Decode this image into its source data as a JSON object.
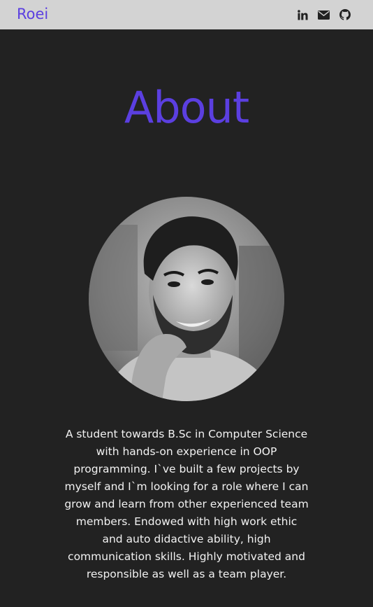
{
  "navbar": {
    "brand": "Roei",
    "icons": [
      "linkedin-icon",
      "mail-icon",
      "github-icon"
    ],
    "background": "#d3d3d3",
    "brand_color": "#5b3fe0"
  },
  "about": {
    "title": "About",
    "title_color": "#5b3fe0",
    "bio": "A student towards B.Sc in Computer Science with hands-on experience in OOP programming. I`ve built a few projects by myself and I`m looking for a role where I can grow and learn from other experienced team members. Endowed with high work ethic and auto didactive ability, high communication skills. Highly motivated and responsible as well as a team player."
  },
  "page": {
    "background": "#222222"
  }
}
